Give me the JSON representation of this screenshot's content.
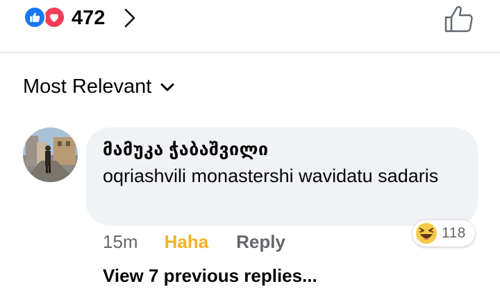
{
  "reactions_summary": {
    "icons": [
      "like-icon",
      "love-icon"
    ],
    "count": "472",
    "like_color": "#1877f2",
    "love_color": "#f33e58"
  },
  "sort": {
    "label": "Most Relevant"
  },
  "comment": {
    "author": "მამუკა ჭაბაშვილი",
    "text": "oqriashvili monastershi wavidatu sadaris",
    "time": "15m",
    "reaction_label": "Haha",
    "reaction_color": "#f7b125",
    "reply_label": "Reply",
    "reaction_emoji": "haha-icon",
    "reaction_count": "118"
  },
  "replies": {
    "view_label": "View 7 previous replies..."
  }
}
